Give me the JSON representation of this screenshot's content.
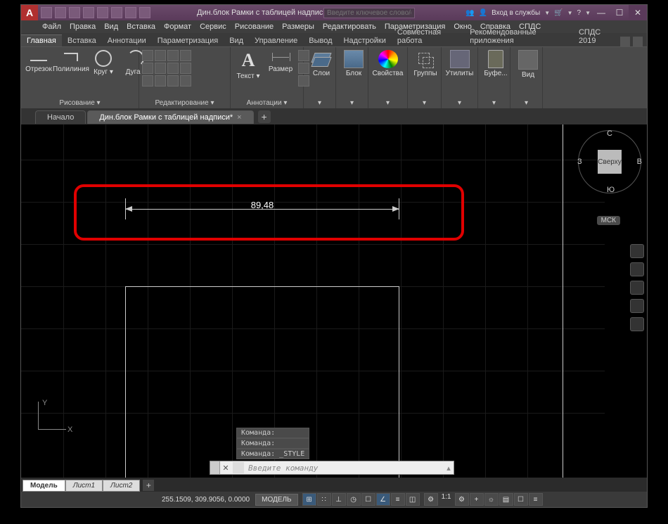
{
  "app_logo": "A",
  "window_title": "Дин.блок Рамки с таблицей надписи...",
  "search_placeholder": "Введите ключевое слово/фразу",
  "signin": "Вход в службы",
  "win_min": "—",
  "win_max": "☐",
  "win_close": "✕",
  "menubar": [
    "Файл",
    "Правка",
    "Вид",
    "Вставка",
    "Формат",
    "Сервис",
    "Рисование",
    "Размеры",
    "Редактировать",
    "Параметризация",
    "Окно",
    "Справка",
    "СПДС"
  ],
  "ribbon_tabs": [
    "Главная",
    "Вставка",
    "Аннотации",
    "Параметризация",
    "Вид",
    "Управление",
    "Вывод",
    "Надстройки",
    "Совместная работа",
    "Рекомендованные приложения",
    "СПДС 2019"
  ],
  "ribbon": {
    "draw": {
      "label": "Рисование ▾",
      "line": "Отрезок",
      "poly": "Полилиния",
      "circle": "Круг ▾",
      "arc": "Дуга ▾"
    },
    "modify": {
      "label": "Редактирование ▾"
    },
    "annot": {
      "label": "Аннотации ▾",
      "text": "Текст ▾",
      "dim": "Размер"
    },
    "layers": {
      "label": "Слои",
      "btn": "Слои"
    },
    "block": {
      "label": "Блок",
      "btn": "Блок"
    },
    "props": {
      "label": "Свойства",
      "btn": "Свойства"
    },
    "groups": {
      "label": "Группы",
      "btn": "Группы"
    },
    "util": {
      "label": "Утилиты",
      "btn": "Утилиты"
    },
    "clip": {
      "label": "Буфе...",
      "btn": "Буфе..."
    },
    "view": {
      "label": "Вид",
      "btn": "Вид"
    }
  },
  "file_tabs": {
    "start": "Начало",
    "active": "Дин.блок Рамки с таблицей надписи*",
    "close": "×",
    "add": "+"
  },
  "viewcube": {
    "top": "Сверху",
    "n": "С",
    "s": "Ю",
    "e": "В",
    "w": "З"
  },
  "wcs": "МСК",
  "dimension_value": "89,48",
  "ucs": {
    "x": "X",
    "y": "Y"
  },
  "cmd_history": [
    "Команда:",
    "Команда:",
    "Команда: _STYLE"
  ],
  "cmd_placeholder": "Введите команду",
  "layout_tabs": {
    "model": "Модель",
    "l1": "Лист1",
    "l2": "Лист2",
    "add": "+"
  },
  "status": {
    "coords": "255.1509, 309.9056, 0.0000",
    "model": "МОДЕЛЬ",
    "scale": "1:1"
  }
}
